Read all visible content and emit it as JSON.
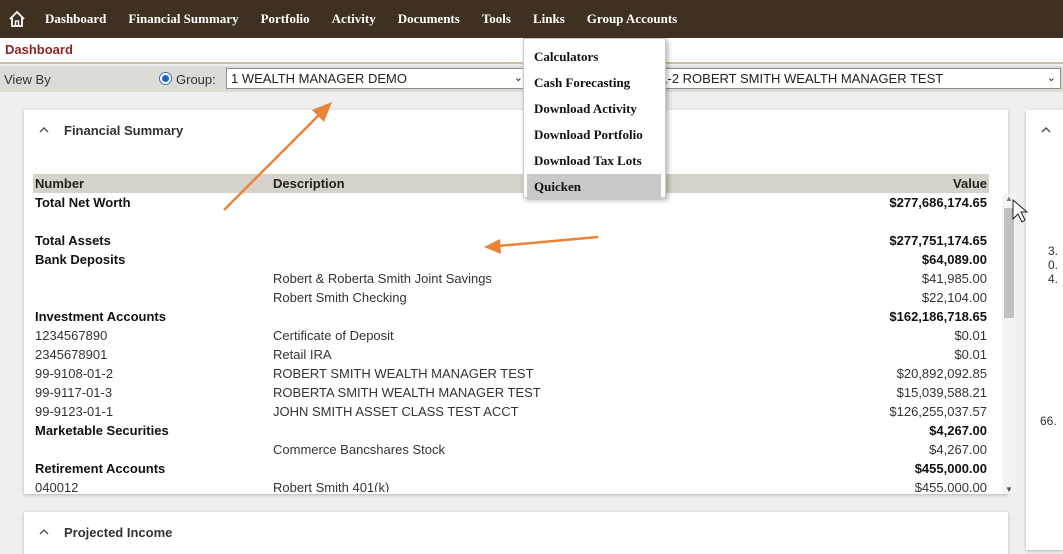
{
  "nav": {
    "items": [
      "Dashboard",
      "Financial Summary",
      "Portfolio",
      "Activity",
      "Documents",
      "Tools",
      "Links",
      "Group Accounts"
    ]
  },
  "page_title": "Dashboard",
  "viewby": {
    "label": "View By",
    "group_label": "Group:",
    "group_value": "1 WEALTH MANAGER DEMO",
    "account_value": "99-9108-01-2 ROBERT SMITH WEALTH MANAGER TEST"
  },
  "tools_menu": {
    "items": [
      "Calculators",
      "Cash Forecasting",
      "Download Activity",
      "Download Portfolio",
      "Download Tax Lots",
      "Quicken"
    ],
    "highlighted": "Quicken"
  },
  "financial_summary": {
    "title": "Financial Summary",
    "columns": {
      "number": "Number",
      "description": "Description",
      "value": "Value"
    },
    "rows": [
      {
        "number": "Total Net Worth",
        "description": "",
        "value": "$277,686,174.65",
        "bold": true
      },
      {
        "number": "",
        "description": "",
        "value": "",
        "spacer": true
      },
      {
        "number": "Total Assets",
        "description": "",
        "value": "$277,751,174.65",
        "bold": true
      },
      {
        "number": "Bank Deposits",
        "description": "",
        "value": "$64,089.00",
        "bold": true
      },
      {
        "number": "",
        "description": "Robert & Roberta Smith Joint Savings",
        "value": "$41,985.00"
      },
      {
        "number": "",
        "description": "Robert Smith Checking",
        "value": "$22,104.00"
      },
      {
        "number": "Investment Accounts",
        "description": "",
        "value": "$162,186,718.65",
        "bold": true
      },
      {
        "number": "1234567890",
        "description": "Certificate of Deposit",
        "value": "$0.01"
      },
      {
        "number": "2345678901",
        "description": "Retail IRA",
        "value": "$0.01"
      },
      {
        "number": "99-9108-01-2",
        "description": "ROBERT SMITH WEALTH MANAGER TEST",
        "value": "$20,892,092.85"
      },
      {
        "number": "99-9117-01-3",
        "description": "ROBERTA SMITH WEALTH MANAGER TEST",
        "value": "$15,039,588.21"
      },
      {
        "number": "99-9123-01-1",
        "description": "JOHN SMITH ASSET CLASS TEST ACCT",
        "value": "$126,255,037.57"
      },
      {
        "number": "Marketable Securities",
        "description": "",
        "value": "$4,267.00",
        "bold": true
      },
      {
        "number": "",
        "description": "Commerce Bancshares Stock",
        "value": "$4,267.00"
      },
      {
        "number": "Retirement Accounts",
        "description": "",
        "value": "$455,000.00",
        "bold": true
      },
      {
        "number": "040012",
        "description": "Robert Smith 401(k)",
        "value": "$455,000.00"
      }
    ]
  },
  "projected_income": {
    "title": "Projected Income"
  },
  "right_panel": {
    "values": [
      "3.",
      "0.",
      "4.",
      "66."
    ]
  },
  "colors": {
    "nav_bg": "#3f3122",
    "title_red": "#8b2525",
    "arrow": "#e8833a",
    "menu_highlight": "#c8c8c8"
  }
}
